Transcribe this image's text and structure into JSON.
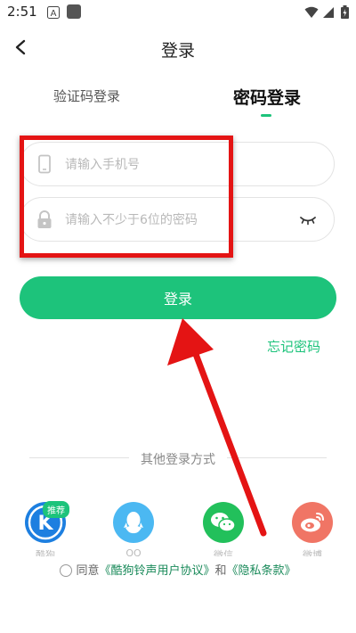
{
  "status_bar": {
    "time": "2:51"
  },
  "header": {
    "title": "登录"
  },
  "tabs": {
    "sms": "验证码登录",
    "password": "密码登录"
  },
  "form": {
    "phone_placeholder": "请输入手机号",
    "password_placeholder": "请输入不少于6位的密码",
    "login_label": "登录",
    "forgot_label": "忘记密码"
  },
  "other_login": {
    "title": "其他登录方式",
    "badge": "推荐",
    "items": [
      {
        "name": "kugou",
        "icon": "kugou-k-icon",
        "label": "酷狗"
      },
      {
        "name": "qq",
        "icon": "qq-icon",
        "label": "QQ"
      },
      {
        "name": "wechat",
        "icon": "wechat-icon",
        "label": "微信"
      },
      {
        "name": "weibo",
        "icon": "weibo-icon",
        "label": "微博"
      }
    ]
  },
  "agreement": {
    "prefix": "同意",
    "user_agreement": "《酷狗铃声用户协议》",
    "and": "和",
    "privacy": "《隐私条款》"
  },
  "colors": {
    "accent": "#1dc37b",
    "annotation": "#e41414"
  }
}
